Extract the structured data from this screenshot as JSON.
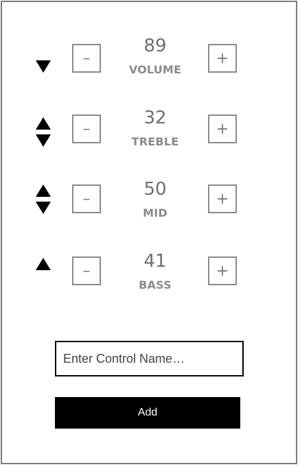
{
  "controls": [
    {
      "value": "89",
      "label": "VOLUME",
      "minus_label": "–",
      "plus_label": "+",
      "arrows": "down"
    },
    {
      "value": "32",
      "label": "TREBLE",
      "minus_label": "–",
      "plus_label": "+",
      "arrows": "both"
    },
    {
      "value": "50",
      "label": "MID",
      "minus_label": "–",
      "plus_label": "+",
      "arrows": "both"
    },
    {
      "value": "41",
      "label": "BASS",
      "minus_label": "–",
      "plus_label": "+",
      "arrows": "up"
    }
  ],
  "form": {
    "placeholder": "Enter Control Name…",
    "value": "",
    "add_label": "Add"
  },
  "colors": {
    "button_bg": "#000000",
    "button_text": "#ffffff",
    "value_text": "#6f6f6f",
    "label_text": "#8a8a8a"
  }
}
